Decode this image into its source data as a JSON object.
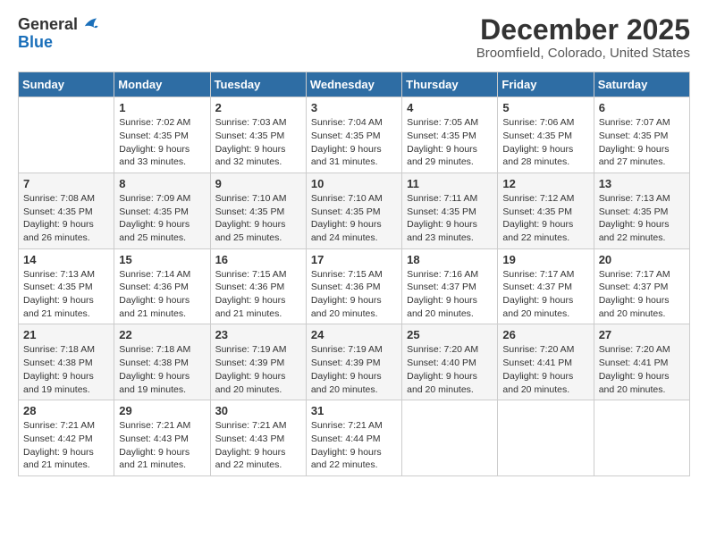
{
  "logo": {
    "general": "General",
    "blue": "Blue"
  },
  "title": "December 2025",
  "subtitle": "Broomfield, Colorado, United States",
  "days_of_week": [
    "Sunday",
    "Monday",
    "Tuesday",
    "Wednesday",
    "Thursday",
    "Friday",
    "Saturday"
  ],
  "weeks": [
    [
      {
        "day": "",
        "info": ""
      },
      {
        "day": "1",
        "info": "Sunrise: 7:02 AM\nSunset: 4:35 PM\nDaylight: 9 hours\nand 33 minutes."
      },
      {
        "day": "2",
        "info": "Sunrise: 7:03 AM\nSunset: 4:35 PM\nDaylight: 9 hours\nand 32 minutes."
      },
      {
        "day": "3",
        "info": "Sunrise: 7:04 AM\nSunset: 4:35 PM\nDaylight: 9 hours\nand 31 minutes."
      },
      {
        "day": "4",
        "info": "Sunrise: 7:05 AM\nSunset: 4:35 PM\nDaylight: 9 hours\nand 29 minutes."
      },
      {
        "day": "5",
        "info": "Sunrise: 7:06 AM\nSunset: 4:35 PM\nDaylight: 9 hours\nand 28 minutes."
      },
      {
        "day": "6",
        "info": "Sunrise: 7:07 AM\nSunset: 4:35 PM\nDaylight: 9 hours\nand 27 minutes."
      }
    ],
    [
      {
        "day": "7",
        "info": "Sunrise: 7:08 AM\nSunset: 4:35 PM\nDaylight: 9 hours\nand 26 minutes."
      },
      {
        "day": "8",
        "info": "Sunrise: 7:09 AM\nSunset: 4:35 PM\nDaylight: 9 hours\nand 25 minutes."
      },
      {
        "day": "9",
        "info": "Sunrise: 7:10 AM\nSunset: 4:35 PM\nDaylight: 9 hours\nand 25 minutes."
      },
      {
        "day": "10",
        "info": "Sunrise: 7:10 AM\nSunset: 4:35 PM\nDaylight: 9 hours\nand 24 minutes."
      },
      {
        "day": "11",
        "info": "Sunrise: 7:11 AM\nSunset: 4:35 PM\nDaylight: 9 hours\nand 23 minutes."
      },
      {
        "day": "12",
        "info": "Sunrise: 7:12 AM\nSunset: 4:35 PM\nDaylight: 9 hours\nand 22 minutes."
      },
      {
        "day": "13",
        "info": "Sunrise: 7:13 AM\nSunset: 4:35 PM\nDaylight: 9 hours\nand 22 minutes."
      }
    ],
    [
      {
        "day": "14",
        "info": "Sunrise: 7:13 AM\nSunset: 4:35 PM\nDaylight: 9 hours\nand 21 minutes."
      },
      {
        "day": "15",
        "info": "Sunrise: 7:14 AM\nSunset: 4:36 PM\nDaylight: 9 hours\nand 21 minutes."
      },
      {
        "day": "16",
        "info": "Sunrise: 7:15 AM\nSunset: 4:36 PM\nDaylight: 9 hours\nand 21 minutes."
      },
      {
        "day": "17",
        "info": "Sunrise: 7:15 AM\nSunset: 4:36 PM\nDaylight: 9 hours\nand 20 minutes."
      },
      {
        "day": "18",
        "info": "Sunrise: 7:16 AM\nSunset: 4:37 PM\nDaylight: 9 hours\nand 20 minutes."
      },
      {
        "day": "19",
        "info": "Sunrise: 7:17 AM\nSunset: 4:37 PM\nDaylight: 9 hours\nand 20 minutes."
      },
      {
        "day": "20",
        "info": "Sunrise: 7:17 AM\nSunset: 4:37 PM\nDaylight: 9 hours\nand 20 minutes."
      }
    ],
    [
      {
        "day": "21",
        "info": "Sunrise: 7:18 AM\nSunset: 4:38 PM\nDaylight: 9 hours\nand 19 minutes."
      },
      {
        "day": "22",
        "info": "Sunrise: 7:18 AM\nSunset: 4:38 PM\nDaylight: 9 hours\nand 19 minutes."
      },
      {
        "day": "23",
        "info": "Sunrise: 7:19 AM\nSunset: 4:39 PM\nDaylight: 9 hours\nand 20 minutes."
      },
      {
        "day": "24",
        "info": "Sunrise: 7:19 AM\nSunset: 4:39 PM\nDaylight: 9 hours\nand 20 minutes."
      },
      {
        "day": "25",
        "info": "Sunrise: 7:20 AM\nSunset: 4:40 PM\nDaylight: 9 hours\nand 20 minutes."
      },
      {
        "day": "26",
        "info": "Sunrise: 7:20 AM\nSunset: 4:41 PM\nDaylight: 9 hours\nand 20 minutes."
      },
      {
        "day": "27",
        "info": "Sunrise: 7:20 AM\nSunset: 4:41 PM\nDaylight: 9 hours\nand 20 minutes."
      }
    ],
    [
      {
        "day": "28",
        "info": "Sunrise: 7:21 AM\nSunset: 4:42 PM\nDaylight: 9 hours\nand 21 minutes."
      },
      {
        "day": "29",
        "info": "Sunrise: 7:21 AM\nSunset: 4:43 PM\nDaylight: 9 hours\nand 21 minutes."
      },
      {
        "day": "30",
        "info": "Sunrise: 7:21 AM\nSunset: 4:43 PM\nDaylight: 9 hours\nand 22 minutes."
      },
      {
        "day": "31",
        "info": "Sunrise: 7:21 AM\nSunset: 4:44 PM\nDaylight: 9 hours\nand 22 minutes."
      },
      {
        "day": "",
        "info": ""
      },
      {
        "day": "",
        "info": ""
      },
      {
        "day": "",
        "info": ""
      }
    ]
  ]
}
